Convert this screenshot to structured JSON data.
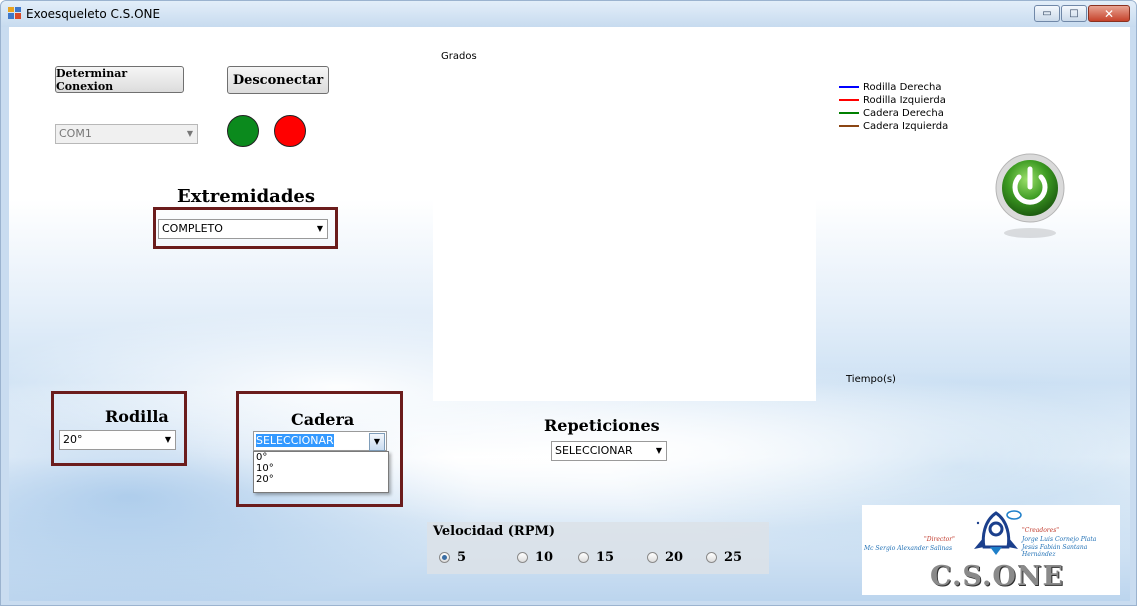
{
  "window": {
    "title": "Exoesqueleto  C.S.ONE",
    "controls": {
      "minimize": "▭",
      "maximize": "□",
      "close": "✕"
    }
  },
  "connection": {
    "determine_label": "Determinar Conexion",
    "disconnect_label": "Desconectar",
    "port_value": "COM1",
    "led_connected_color": "#0b8a1d",
    "led_disconnected_color": "#ff0000"
  },
  "extremidades": {
    "title": "Extremidades",
    "value": "COMPLETO"
  },
  "rodilla": {
    "title": "Rodilla",
    "value": "20°"
  },
  "cadera": {
    "title": "Cadera",
    "value": "SELECCIONAR",
    "options": [
      "0°",
      "10°",
      "20°"
    ]
  },
  "repeticiones": {
    "title": "Repeticiones",
    "value": "SELECCIONAR"
  },
  "chart": {
    "ylabel": "Grados",
    "xlabel": "Tiempo(s)",
    "legend": [
      {
        "name": "Rodilla Derecha",
        "color": "#0000ff"
      },
      {
        "name": "Rodilla Izquierda",
        "color": "#ff0000"
      },
      {
        "name": "Cadera Derecha",
        "color": "#008000"
      },
      {
        "name": "Cadera Izquierda",
        "color": "#8b4513"
      }
    ]
  },
  "velocidad": {
    "title": "Velocidad (RPM)",
    "options": [
      "5",
      "10",
      "15",
      "20",
      "25"
    ],
    "selected": "5"
  },
  "power_icon": "power-icon",
  "logo": {
    "director_title": "\"Director\"",
    "director_name": "Mc Sergio Alexander Salinas",
    "creators_title": "\"Creadores\"",
    "creator_1": "Jorge Luis Cornejo Plata",
    "creator_2": "Jesús Fabián Santana Hernández",
    "brand": "C.S.ONE"
  }
}
